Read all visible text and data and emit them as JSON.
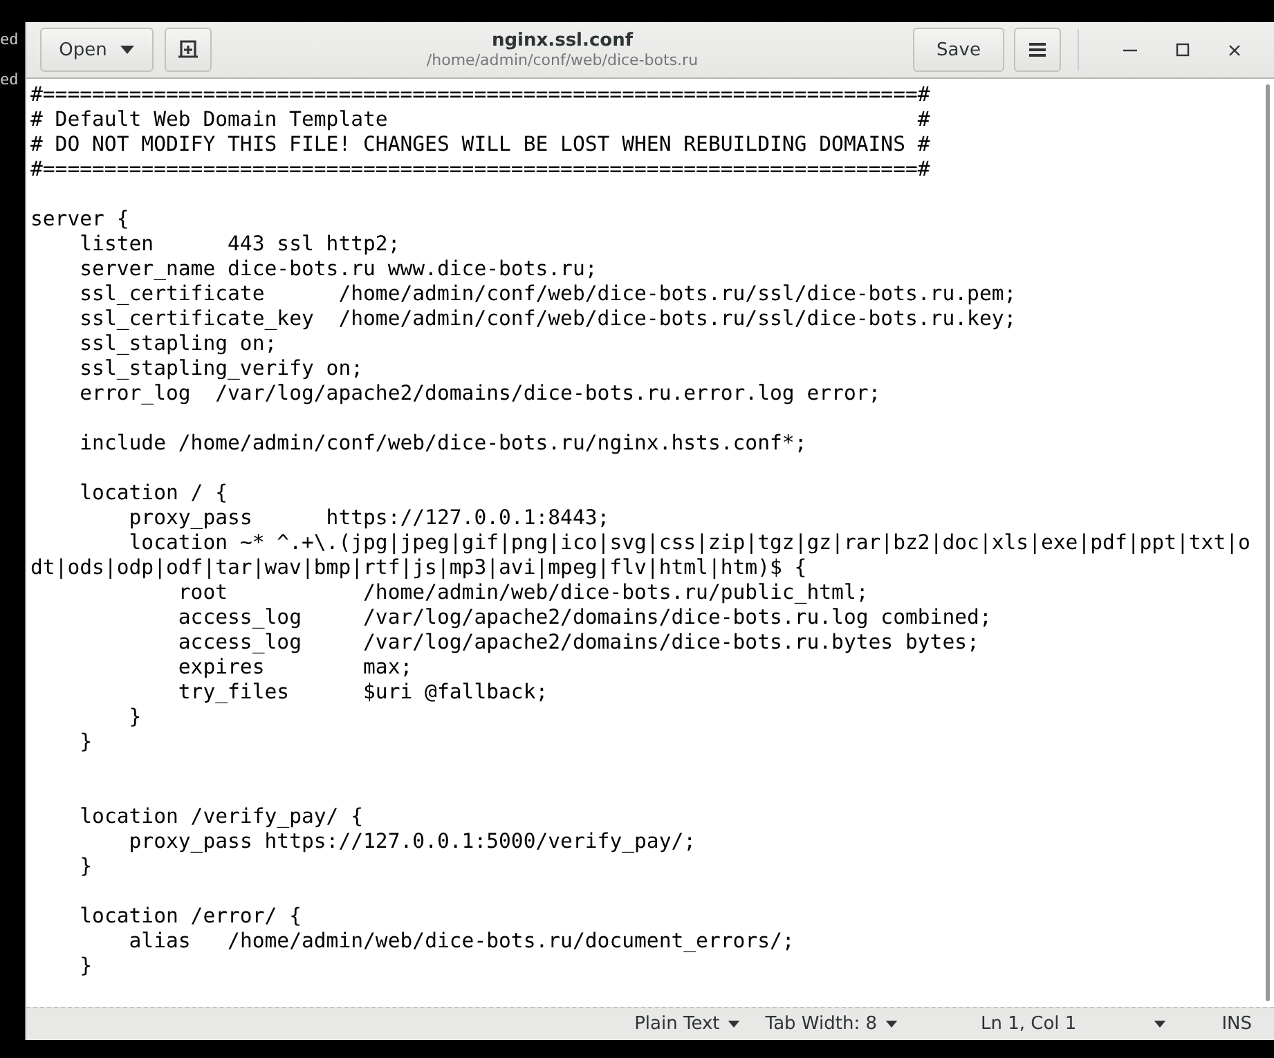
{
  "terminal": {
    "fragments": [
      "ed",
      "ed"
    ]
  },
  "header": {
    "open_button": {
      "label": "Open"
    },
    "title": "nginx.ssl.conf",
    "subtitle": "/home/admin/conf/web/dice-bots.ru",
    "save_button": {
      "label": "Save"
    }
  },
  "editor": {
    "text": "#=======================================================================#\n# Default Web Domain Template                                           #\n# DO NOT MODIFY THIS FILE! CHANGES WILL BE LOST WHEN REBUILDING DOMAINS #\n#=======================================================================#\n\nserver {\n    listen      443 ssl http2;\n    server_name dice-bots.ru www.dice-bots.ru;\n    ssl_certificate      /home/admin/conf/web/dice-bots.ru/ssl/dice-bots.ru.pem;\n    ssl_certificate_key  /home/admin/conf/web/dice-bots.ru/ssl/dice-bots.ru.key;\n    ssl_stapling on;\n    ssl_stapling_verify on;\n    error_log  /var/log/apache2/domains/dice-bots.ru.error.log error;\n\n    include /home/admin/conf/web/dice-bots.ru/nginx.hsts.conf*;\n\n    location / {\n        proxy_pass      https://127.0.0.1:8443;\n        location ~* ^.+\\.(jpg|jpeg|gif|png|ico|svg|css|zip|tgz|gz|rar|bz2|doc|xls|exe|pdf|ppt|txt|odt|ods|odp|odf|tar|wav|bmp|rtf|js|mp3|avi|mpeg|flv|html|htm)$ {\n            root           /home/admin/web/dice-bots.ru/public_html;\n            access_log     /var/log/apache2/domains/dice-bots.ru.log combined;\n            access_log     /var/log/apache2/domains/dice-bots.ru.bytes bytes;\n            expires        max;\n            try_files      $uri @fallback;\n        }\n    }\n\n\n    location /verify_pay/ {\n        proxy_pass https://127.0.0.1:5000/verify_pay/;\n    }\n\n    location /error/ {\n        alias   /home/admin/web/dice-bots.ru/document_errors/;\n    }"
  },
  "status_bar": {
    "language": "Plain Text",
    "tab_width": "Tab Width: 8",
    "position": "Ln 1, Col 1",
    "mode": "INS"
  }
}
